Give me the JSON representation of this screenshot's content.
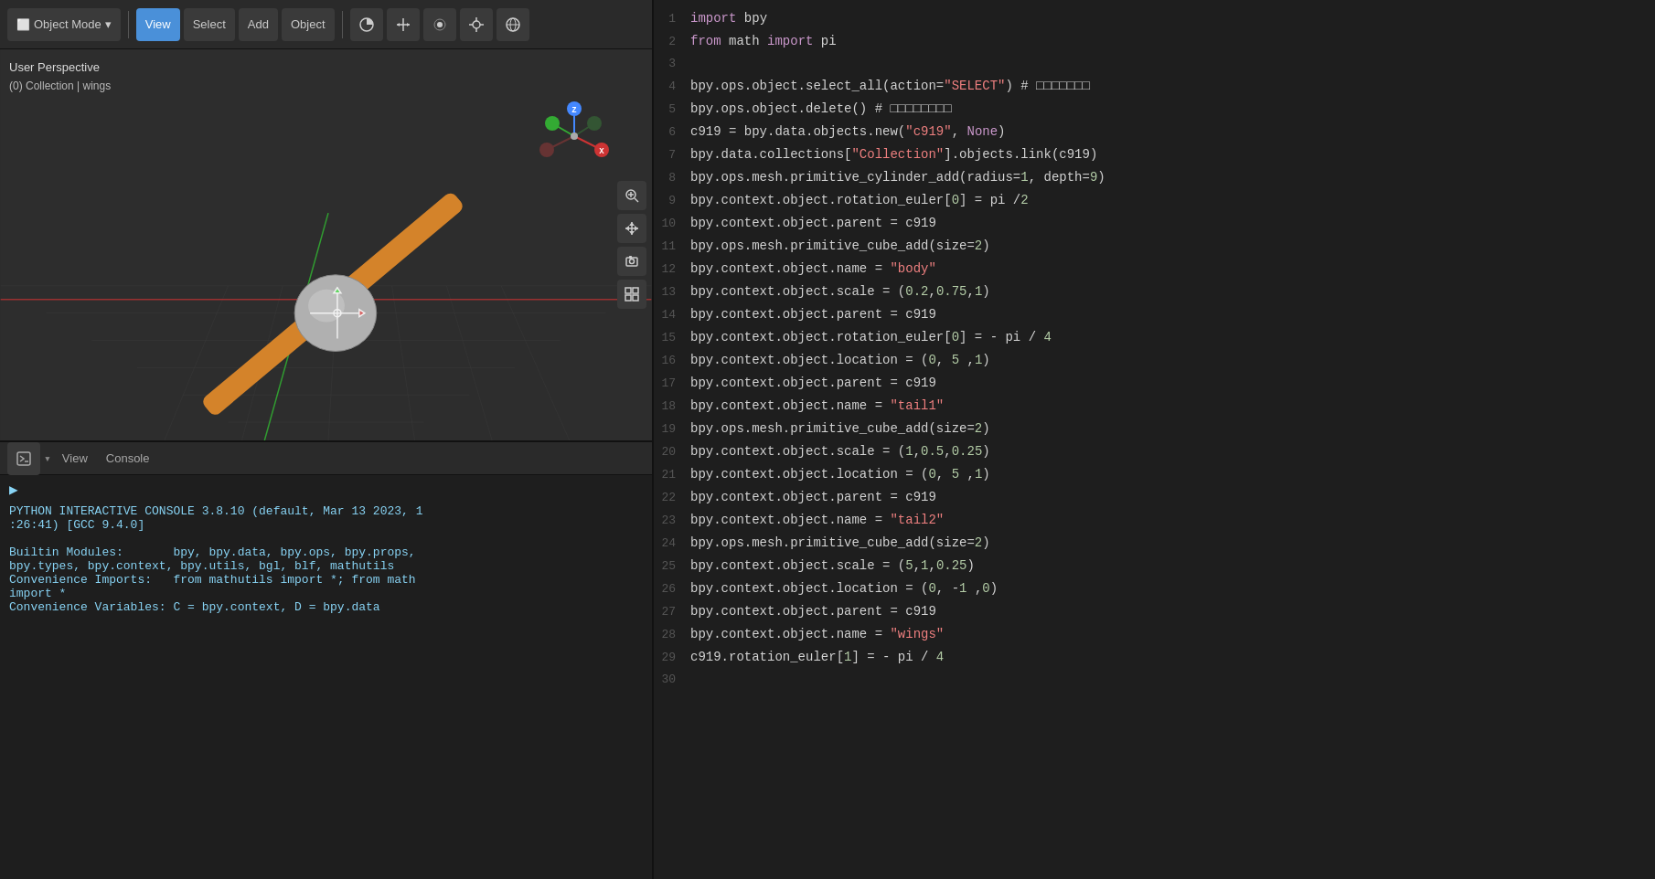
{
  "toolbar": {
    "object_mode_label": "Object Mode",
    "view_label": "View",
    "select_label": "Select",
    "add_label": "Add",
    "object_label": "Object",
    "dropdown_arrow": "▾"
  },
  "viewport": {
    "label_line1": "User Perspective",
    "label_line2": "(0) Collection | wings"
  },
  "console": {
    "view_label": "View",
    "console_label": "Console",
    "content": [
      "",
      "PYTHON INTERACTIVE CONSOLE 3.8.10 (default, Mar 13 2023, 1",
      ":26:41)  [GCC 9.4.0]",
      "",
      "Builtin Modules:       bpy, bpy.data, bpy.ops, bpy.props,",
      "bpy.types, bpy.context, bpy.utils, bgl, blf, mathutils",
      "Convenience Imports:   from mathutils import *; from math",
      "import *",
      "Convenience Variables: C = bpy.context, D = bpy.data"
    ]
  },
  "code_lines": [
    {
      "num": 1,
      "tokens": [
        {
          "t": "kw-import",
          "v": "import"
        },
        {
          "t": "plain",
          "v": " bpy"
        }
      ]
    },
    {
      "num": 2,
      "tokens": [
        {
          "t": "kw-from",
          "v": "from"
        },
        {
          "t": "plain",
          "v": " math "
        },
        {
          "t": "kw-import",
          "v": "import"
        },
        {
          "t": "plain",
          "v": " pi"
        }
      ]
    },
    {
      "num": 3,
      "tokens": [
        {
          "t": "plain",
          "v": ""
        }
      ]
    },
    {
      "num": 4,
      "tokens": [
        {
          "t": "plain",
          "v": "bpy.ops.object.select_all(action="
        },
        {
          "t": "str",
          "v": "\"SELECT\""
        },
        {
          "t": "plain",
          "v": ") # □□□□□□□"
        }
      ]
    },
    {
      "num": 5,
      "tokens": [
        {
          "t": "plain",
          "v": "bpy.ops.object.delete() # □□□□□□□□"
        }
      ]
    },
    {
      "num": 6,
      "tokens": [
        {
          "t": "plain",
          "v": "c919 = bpy.data.objects.new("
        },
        {
          "t": "str",
          "v": "\"c919\""
        },
        {
          "t": "plain",
          "v": ", "
        },
        {
          "t": "kw-none",
          "v": "None"
        },
        {
          "t": "plain",
          "v": ")"
        }
      ]
    },
    {
      "num": 7,
      "tokens": [
        {
          "t": "plain",
          "v": "bpy.data.collections["
        },
        {
          "t": "str",
          "v": "\"Collection\""
        },
        {
          "t": "plain",
          "v": "].objects.link(c919)"
        }
      ]
    },
    {
      "num": 8,
      "tokens": [
        {
          "t": "plain",
          "v": "bpy.ops.mesh.primitive_cylinder_add(radius="
        },
        {
          "t": "num",
          "v": "1"
        },
        {
          "t": "plain",
          "v": ", depth="
        },
        {
          "t": "num",
          "v": "9"
        },
        {
          "t": "plain",
          "v": ")"
        }
      ]
    },
    {
      "num": 9,
      "tokens": [
        {
          "t": "plain",
          "v": "bpy.context.object.rotation_euler["
        },
        {
          "t": "num",
          "v": "0"
        },
        {
          "t": "plain",
          "v": "] = pi /"
        },
        {
          "t": "num",
          "v": "2"
        }
      ]
    },
    {
      "num": 10,
      "tokens": [
        {
          "t": "plain",
          "v": "bpy.context.object.parent = c919"
        }
      ]
    },
    {
      "num": 11,
      "tokens": [
        {
          "t": "plain",
          "v": "bpy.ops.mesh.primitive_cube_add(size="
        },
        {
          "t": "num",
          "v": "2"
        },
        {
          "t": "plain",
          "v": ")"
        }
      ]
    },
    {
      "num": 12,
      "tokens": [
        {
          "t": "plain",
          "v": "bpy.context.object.name = "
        },
        {
          "t": "str",
          "v": "\"body\""
        }
      ]
    },
    {
      "num": 13,
      "tokens": [
        {
          "t": "plain",
          "v": "bpy.context.object.scale = ("
        },
        {
          "t": "num",
          "v": "0.2"
        },
        {
          "t": "plain",
          "v": ","
        },
        {
          "t": "num",
          "v": "0.75"
        },
        {
          "t": "plain",
          "v": ","
        },
        {
          "t": "num",
          "v": "1"
        },
        {
          "t": "plain",
          "v": ")"
        }
      ]
    },
    {
      "num": 14,
      "tokens": [
        {
          "t": "plain",
          "v": "bpy.context.object.parent = c919"
        }
      ]
    },
    {
      "num": 15,
      "tokens": [
        {
          "t": "plain",
          "v": "bpy.context.object.rotation_euler["
        },
        {
          "t": "num",
          "v": "0"
        },
        {
          "t": "plain",
          "v": "] = - pi / "
        },
        {
          "t": "num",
          "v": "4"
        }
      ]
    },
    {
      "num": 16,
      "tokens": [
        {
          "t": "plain",
          "v": "bpy.context.object.location = ("
        },
        {
          "t": "num",
          "v": "0"
        },
        {
          "t": "plain",
          "v": ", "
        },
        {
          "t": "num",
          "v": "5"
        },
        {
          "t": "plain",
          "v": " ,"
        },
        {
          "t": "num",
          "v": "1"
        },
        {
          "t": "plain",
          "v": ")"
        }
      ]
    },
    {
      "num": 17,
      "tokens": [
        {
          "t": "plain",
          "v": "bpy.context.object.parent = c919"
        }
      ]
    },
    {
      "num": 18,
      "tokens": [
        {
          "t": "plain",
          "v": "bpy.context.object.name = "
        },
        {
          "t": "str",
          "v": "\"tail1\""
        }
      ]
    },
    {
      "num": 19,
      "tokens": [
        {
          "t": "plain",
          "v": "bpy.ops.mesh.primitive_cube_add(size="
        },
        {
          "t": "num",
          "v": "2"
        },
        {
          "t": "plain",
          "v": ")"
        }
      ]
    },
    {
      "num": 20,
      "tokens": [
        {
          "t": "plain",
          "v": "bpy.context.object.scale = ("
        },
        {
          "t": "num",
          "v": "1"
        },
        {
          "t": "plain",
          "v": ","
        },
        {
          "t": "num",
          "v": "0.5"
        },
        {
          "t": "plain",
          "v": ","
        },
        {
          "t": "num",
          "v": "0.25"
        },
        {
          "t": "plain",
          "v": ")"
        }
      ]
    },
    {
      "num": 21,
      "tokens": [
        {
          "t": "plain",
          "v": "bpy.context.object.location = ("
        },
        {
          "t": "num",
          "v": "0"
        },
        {
          "t": "plain",
          "v": ", "
        },
        {
          "t": "num",
          "v": "5"
        },
        {
          "t": "plain",
          "v": " ,"
        },
        {
          "t": "num",
          "v": "1"
        },
        {
          "t": "plain",
          "v": ")"
        }
      ]
    },
    {
      "num": 22,
      "tokens": [
        {
          "t": "plain",
          "v": "bpy.context.object.parent = c919"
        }
      ]
    },
    {
      "num": 23,
      "tokens": [
        {
          "t": "plain",
          "v": "bpy.context.object.name = "
        },
        {
          "t": "str",
          "v": "\"tail2\""
        }
      ]
    },
    {
      "num": 24,
      "tokens": [
        {
          "t": "plain",
          "v": "bpy.ops.mesh.primitive_cube_add(size="
        },
        {
          "t": "num",
          "v": "2"
        },
        {
          "t": "plain",
          "v": ")"
        }
      ]
    },
    {
      "num": 25,
      "tokens": [
        {
          "t": "plain",
          "v": "bpy.context.object.scale = ("
        },
        {
          "t": "num",
          "v": "5"
        },
        {
          "t": "plain",
          "v": ","
        },
        {
          "t": "num",
          "v": "1"
        },
        {
          "t": "plain",
          "v": ","
        },
        {
          "t": "num",
          "v": "0.25"
        },
        {
          "t": "plain",
          "v": ")"
        }
      ]
    },
    {
      "num": 26,
      "tokens": [
        {
          "t": "plain",
          "v": "bpy.context.object.location = ("
        },
        {
          "t": "num",
          "v": "0"
        },
        {
          "t": "plain",
          "v": ", -"
        },
        {
          "t": "num",
          "v": "1"
        },
        {
          "t": "plain",
          "v": " ,"
        },
        {
          "t": "num",
          "v": "0"
        },
        {
          "t": "plain",
          "v": ")"
        }
      ]
    },
    {
      "num": 27,
      "tokens": [
        {
          "t": "plain",
          "v": "bpy.context.object.parent = c919"
        }
      ]
    },
    {
      "num": 28,
      "tokens": [
        {
          "t": "plain",
          "v": "bpy.context.object.name = "
        },
        {
          "t": "str",
          "v": "\"wings\""
        }
      ]
    },
    {
      "num": 29,
      "tokens": [
        {
          "t": "plain",
          "v": "c919.rotation_euler["
        },
        {
          "t": "num",
          "v": "1"
        },
        {
          "t": "plain",
          "v": "] = - pi / "
        },
        {
          "t": "num",
          "v": "4"
        }
      ]
    },
    {
      "num": 30,
      "tokens": [
        {
          "t": "plain",
          "v": ""
        }
      ]
    }
  ]
}
